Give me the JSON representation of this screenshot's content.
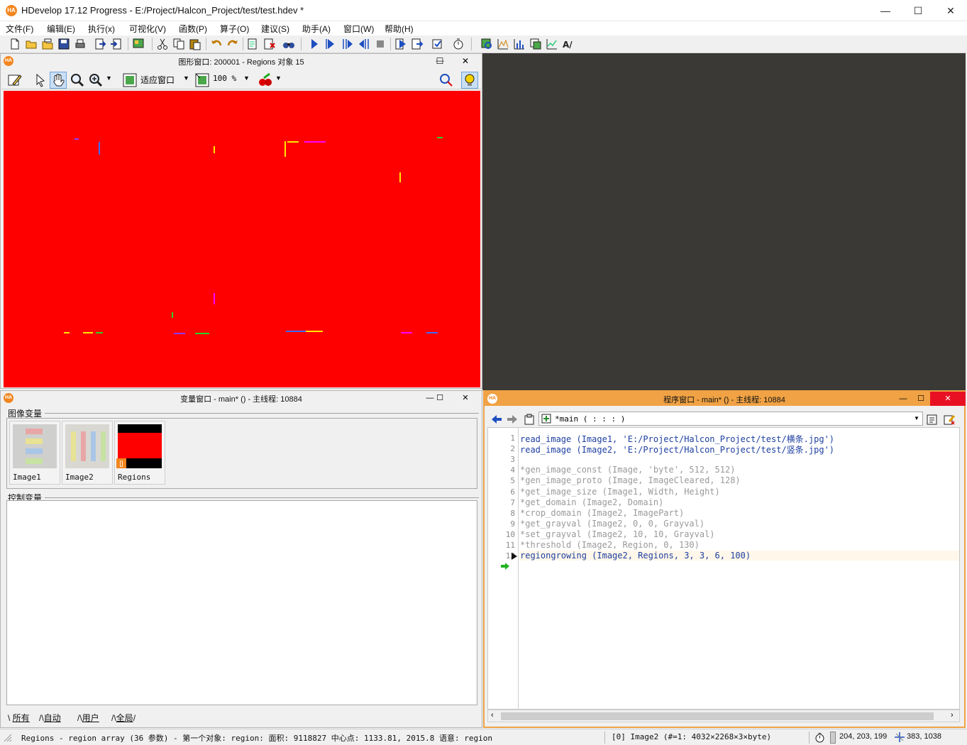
{
  "window": {
    "title": "HDevelop 17.12 Progress - E:/Project/Halcon_Project/test/test.hdev *",
    "logo": "HA",
    "minimize": "—",
    "maximize": "☐",
    "close": "✕"
  },
  "menu": [
    "文件(F)",
    "编辑(E)",
    "执行(x)",
    "可视化(V)",
    "函数(P)",
    "算子(O)",
    "建议(S)",
    "助手(A)",
    "窗口(W)",
    "帮助(H)"
  ],
  "graphics_window": {
    "title": "图形窗口: 200001 - Regions 对象 15",
    "fit_label": "适应窗口",
    "zoom_value": "100 %",
    "canvas_color": "#ff0000"
  },
  "variable_window": {
    "title": "变量窗口 - main* () - 主线程: 10884",
    "iconic_label": "图像变量",
    "control_label": "控制变量",
    "iconic_vars": [
      {
        "name": "Image1"
      },
      {
        "name": "Image2"
      },
      {
        "name": "Regions",
        "badge": "[]"
      }
    ],
    "tabs": [
      "所有",
      "自动",
      "用户",
      "全局"
    ]
  },
  "program_window": {
    "title": "程序窗口 - main* () - 主线程: 10884",
    "procedure": "*main ( : : : )",
    "lines": [
      {
        "n": "1",
        "text": "read_image (Image1, 'E:/Project/Halcon_Project/test/横条.jpg')",
        "kind": "active"
      },
      {
        "n": "2",
        "text": "read_image (Image2, 'E:/Project/Halcon_Project/test/竖条.jpg')",
        "kind": "active"
      },
      {
        "n": "3",
        "text": "",
        "kind": "active"
      },
      {
        "n": "4",
        "text": "*gen_image_const (Image, 'byte', 512, 512)",
        "kind": "comment"
      },
      {
        "n": "5",
        "text": "*gen_image_proto (Image, ImageCleared, 128)",
        "kind": "comment"
      },
      {
        "n": "6",
        "text": "*get_image_size (Image1, Width, Height)",
        "kind": "comment"
      },
      {
        "n": "7",
        "text": "*get_domain (Image2, Domain)",
        "kind": "comment"
      },
      {
        "n": "8",
        "text": "*crop_domain (Image2, ImagePart)",
        "kind": "comment"
      },
      {
        "n": "9",
        "text": "*get_grayval (Image2, 0, 0, Grayval)",
        "kind": "comment"
      },
      {
        "n": "10",
        "text": "*set_grayval (Image2, 10, 10, Grayval)",
        "kind": "comment"
      },
      {
        "n": "11",
        "text": "*threshold (Image2, Region, 0, 130)",
        "kind": "comment"
      },
      {
        "n": "12",
        "text": "regiongrowing (Image2, Regions, 3, 3, 6, 100)",
        "kind": "active"
      }
    ]
  },
  "status": {
    "message": "Regions - region array (36 参数) - 第一个对象: region: 面积: 9118827 中心点: 1133.81, 2015.8 语意: region",
    "image_info": "[0] Image2 (#=1: 4032×2268×3×byte)",
    "color_value": "204, 203, 199",
    "coords": "383, 1038"
  },
  "colors": {
    "accent_orange": "#f0a244",
    "logo_orange": "#f3861f",
    "code_blue": "#1d3fa0",
    "comment_gray": "#9a9a9a",
    "mdi_dark": "#3a3935"
  }
}
